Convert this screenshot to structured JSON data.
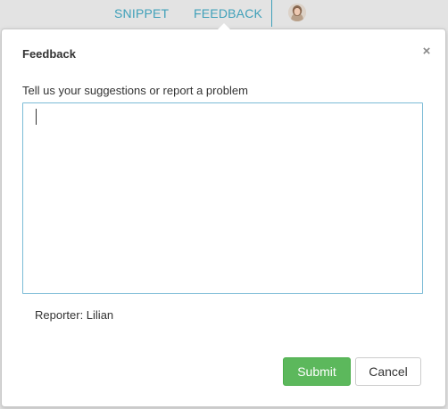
{
  "nav": {
    "snippet_label": "SNIPPET",
    "feedback_label": "FEEDBACK"
  },
  "modal": {
    "title": "Feedback",
    "close_glyph": "×",
    "prompt": "Tell us your suggestions or report a problem",
    "textarea_value": "",
    "reporter_text": "Reporter: Lilian",
    "submit_label": "Submit",
    "cancel_label": "Cancel"
  },
  "colors": {
    "accent": "#3fa0b9",
    "submit_green": "#5cb85c",
    "topbar_bg": "#e3e3e3"
  },
  "icons": {
    "avatar": "user-avatar-icon",
    "close": "close-icon"
  }
}
